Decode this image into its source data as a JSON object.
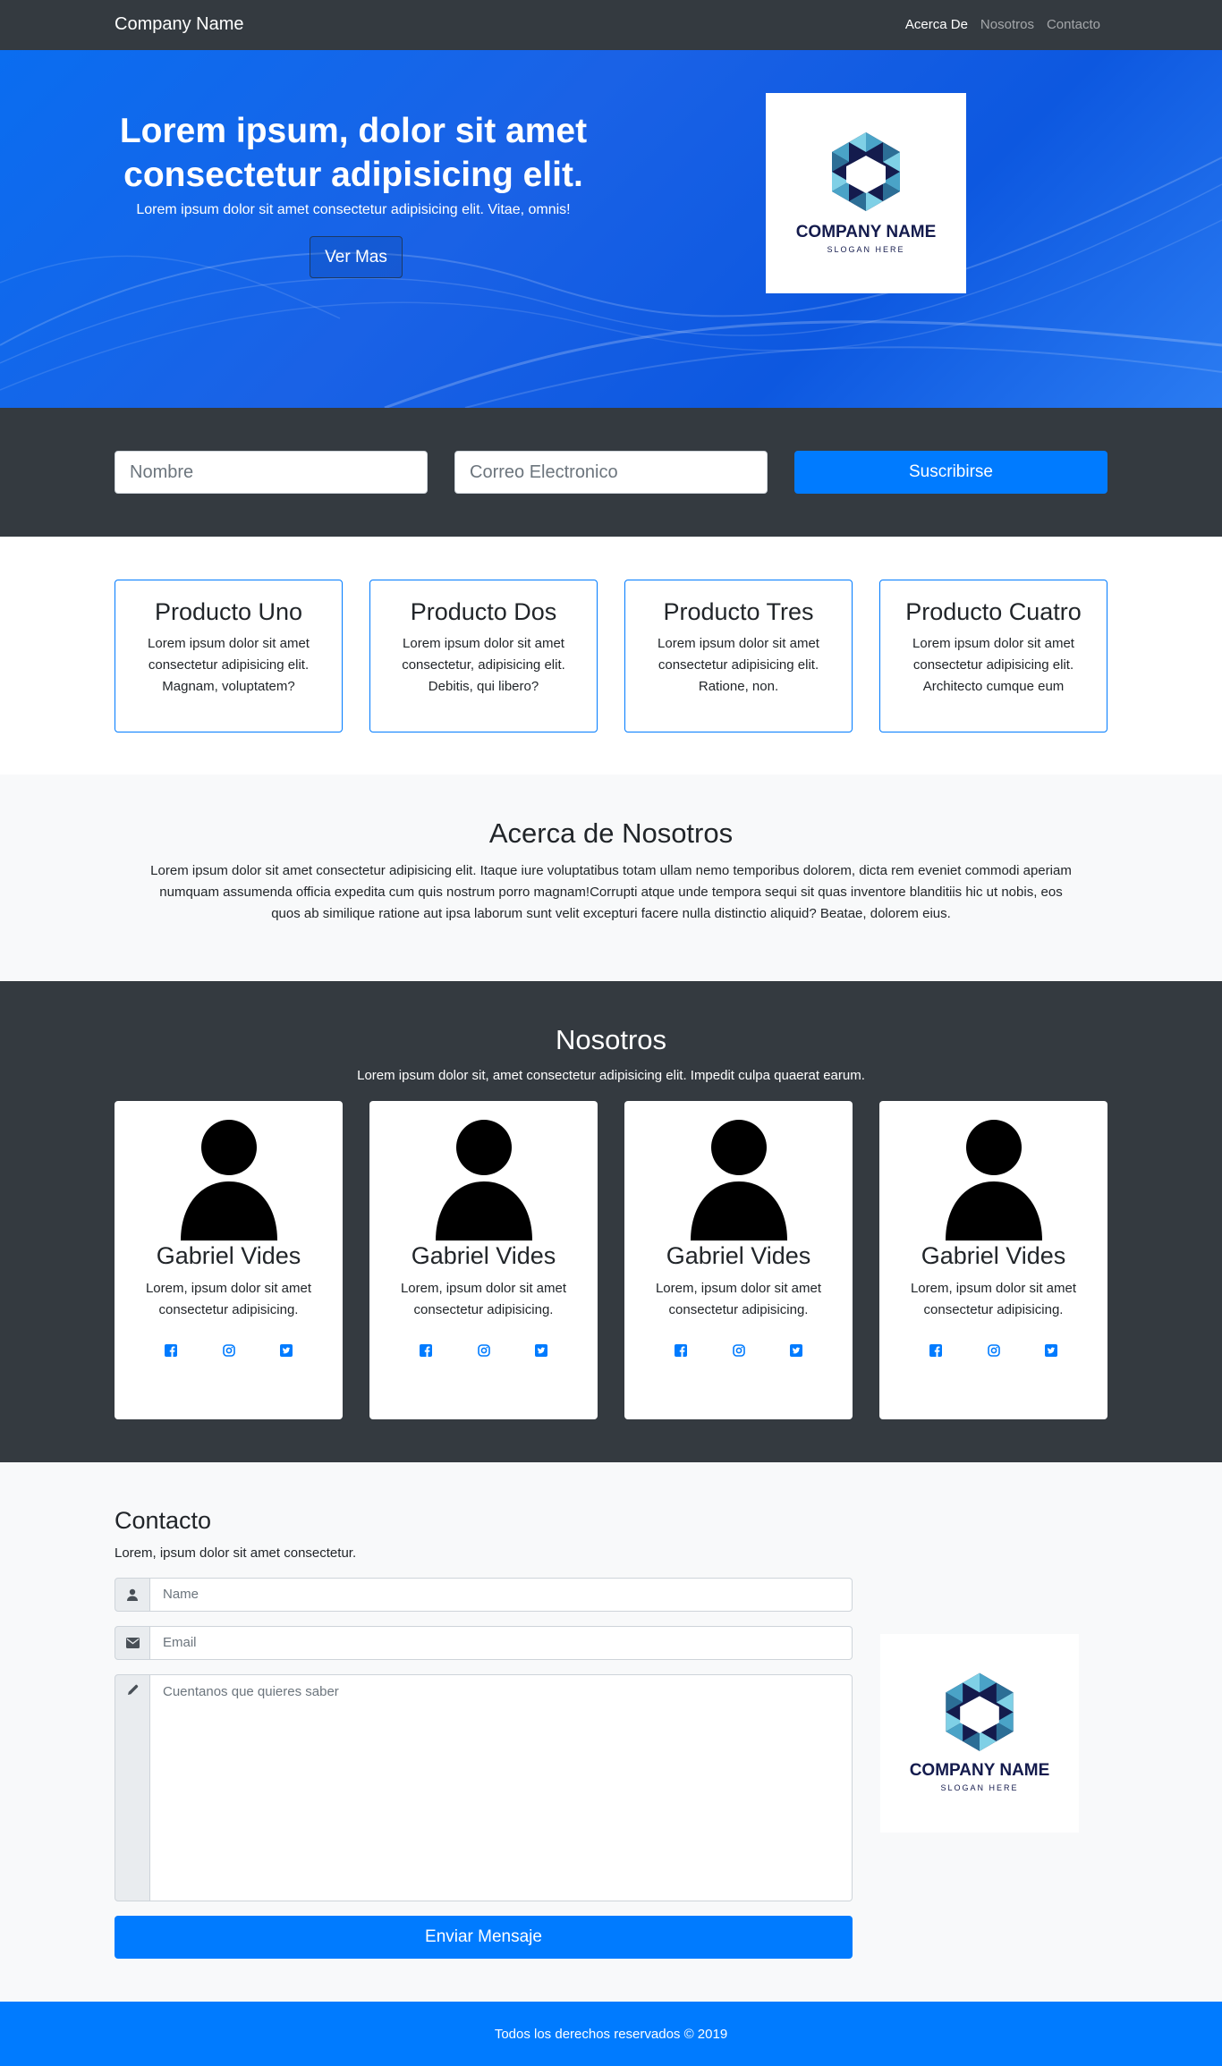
{
  "navbar": {
    "brand": "Company Name",
    "links": [
      "Acerca De",
      "Nosotros",
      "Contacto"
    ]
  },
  "hero": {
    "title": "Lorem ipsum, dolor sit amet consectetur adipisicing elit.",
    "subtitle": "Lorem ipsum dolor sit amet consectetur adipisicing elit. Vitae, omnis!",
    "button": "Ver Mas",
    "logo": {
      "name": "COMPANY NAME",
      "slogan": "SLOGAN HERE"
    }
  },
  "subscribe": {
    "name_placeholder": "Nombre",
    "email_placeholder": "Correo Electronico",
    "button": "Suscribirse"
  },
  "products": [
    {
      "title": "Producto Uno",
      "text": "Lorem ipsum dolor sit amet consectetur adipisicing elit. Magnam, voluptatem?"
    },
    {
      "title": "Producto Dos",
      "text": "Lorem ipsum dolor sit amet consectetur, adipisicing elit. Debitis, qui libero?"
    },
    {
      "title": "Producto Tres",
      "text": "Lorem ipsum dolor sit amet consectetur adipisicing elit. Ratione, non."
    },
    {
      "title": "Producto Cuatro",
      "text": "Lorem ipsum dolor sit amet consectetur adipisicing elit. Architecto cumque eum"
    }
  ],
  "about": {
    "title": "Acerca de Nosotros",
    "text": "Lorem ipsum dolor sit amet consectetur adipisicing elit. Itaque iure voluptatibus totam ullam nemo temporibus dolorem, dicta rem eveniet commodi aperiam numquam assumenda officia expedita cum quis nostrum porro magnam!Corrupti atque unde tempora sequi sit quas inventore blanditiis hic ut nobis, eos quos ab similique ratione aut ipsa laborum sunt velit excepturi facere nulla distinctio aliquid? Beatae, dolorem eius."
  },
  "team": {
    "title": "Nosotros",
    "subtitle": "Lorem ipsum dolor sit, amet consectetur adipisicing elit. Impedit culpa quaerat earum.",
    "members": [
      {
        "name": "Gabriel Vides",
        "text": "Lorem, ipsum dolor sit amet consectetur adipisicing."
      },
      {
        "name": "Gabriel Vides",
        "text": "Lorem, ipsum dolor sit amet consectetur adipisicing."
      },
      {
        "name": "Gabriel Vides",
        "text": "Lorem, ipsum dolor sit amet consectetur adipisicing."
      },
      {
        "name": "Gabriel Vides",
        "text": "Lorem, ipsum dolor sit amet consectetur adipisicing."
      }
    ],
    "social_icons": [
      "facebook-icon",
      "instagram-icon",
      "twitter-icon"
    ]
  },
  "contact": {
    "title": "Contacto",
    "subtitle": "Lorem, ipsum dolor sit amet consectetur.",
    "name_placeholder": "Name",
    "email_placeholder": "Email",
    "message_placeholder": "Cuentanos que quieres saber",
    "button": "Enviar Mensaje",
    "logo": {
      "name": "COMPANY NAME",
      "slogan": "SLOGAN HERE"
    }
  },
  "footer": {
    "text": "Todos los derechos reservados © 2019"
  },
  "colors": {
    "primary": "#007bff",
    "dark": "#343a40",
    "light": "#f8f9fa",
    "logo_navy": "#141b4d"
  }
}
